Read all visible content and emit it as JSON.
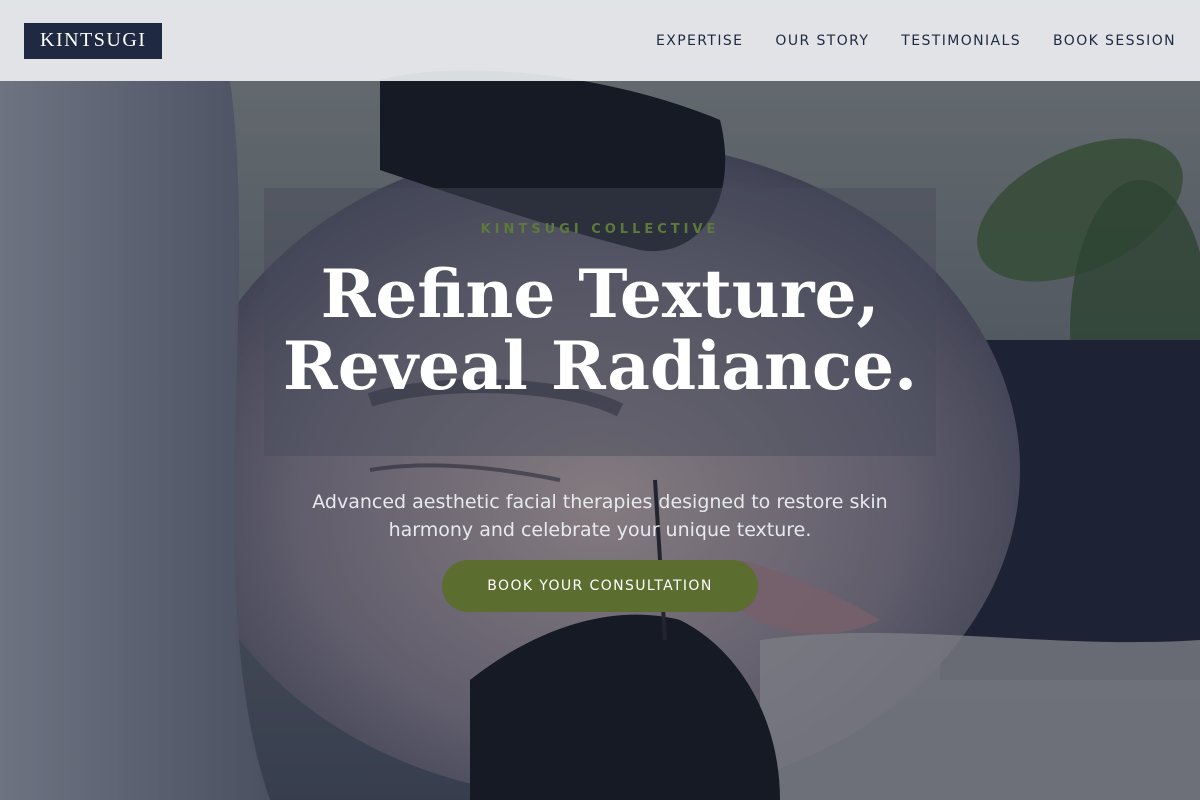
{
  "header": {
    "logo": "KINTSUGI",
    "nav": [
      {
        "label": "EXPERTISE"
      },
      {
        "label": "OUR STORY"
      },
      {
        "label": "TESTIMONIALS"
      },
      {
        "label": "BOOK SESSION"
      }
    ]
  },
  "hero": {
    "eyebrow": "KINTSUGI COLLECTIVE",
    "headline_line1": "Refine Texture,",
    "headline_line2": "Reveal Radiance.",
    "subtext": "Advanced aesthetic facial therapies designed to restore skin harmony and celebrate your unique texture.",
    "cta_label": "BOOK YOUR CONSULTATION",
    "background_image": "facial-treatment-photo"
  },
  "colors": {
    "brand_navy": "#1f2a42",
    "accent_olive": "#5b6e30",
    "eyebrow_green": "#5d7a3a"
  }
}
